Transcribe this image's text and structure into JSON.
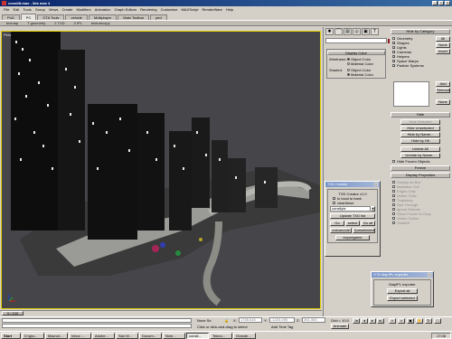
{
  "window": {
    "title": "constlit.max - 3ds max 4"
  },
  "menu": [
    "File",
    "Edit",
    "Tools",
    "Group",
    "Views",
    "Create",
    "Modifiers",
    "Animation",
    "Graph Editors",
    "Rendering",
    "Customize",
    "MAXScript",
    "RenderWare",
    "Help"
  ],
  "tabs": [
    {
      "label": "PoD"
    },
    {
      "label": "PC"
    },
    {
      "label": "GTA Tools"
    },
    {
      "label": "vehicle"
    },
    {
      "label": "Multiplayer"
    },
    {
      "label": "Main Toolbar"
    },
    {
      "label": "ped"
    }
  ],
  "toolrow": [
    "texmap",
    "T geometry",
    "2 TXD",
    "3 IPL",
    "texturecopy"
  ],
  "viewport": {
    "label": "Perspective"
  },
  "display_color": {
    "title": "Display Color",
    "wireframe_label": "Wireframe:",
    "shaded_label": "Shaded:",
    "object_color": "Object Color",
    "material_color": "Material Color"
  },
  "hide_by_category": {
    "title": "Hide by Category",
    "items": [
      {
        "label": "Geometry",
        "checked": false
      },
      {
        "label": "Shapes",
        "checked": true
      },
      {
        "label": "Lights",
        "checked": true
      },
      {
        "label": "Cameras",
        "checked": true
      },
      {
        "label": "Helpers",
        "checked": true
      },
      {
        "label": "Space Warps",
        "checked": true
      },
      {
        "label": "Particle Systems",
        "checked": true
      }
    ],
    "all": "All",
    "none": "None",
    "invert": "Invert",
    "add": "Add",
    "remove": "Remove",
    "none2": "None"
  },
  "hide": {
    "title": "Hide",
    "buttons": [
      "Hide Selected",
      "Hide Unselected",
      "Hide by Name...",
      "Hide by Hit",
      "Unhide All",
      "Unhide by Name...",
      "Hide Frozen Objects"
    ],
    "disabled": [
      true,
      false,
      false,
      false,
      false,
      false,
      false
    ]
  },
  "freeze": {
    "title": "Freeze"
  },
  "display_properties": {
    "title": "Display Properties",
    "items": [
      "Display as Box",
      "Backface Cull",
      "Edges Only",
      "Vertex Ticks",
      "Trajectory",
      "See-Through",
      "Ignore Extents",
      "Show Frozen in Gray",
      "Vertex Colors",
      "Shaded"
    ]
  },
  "txd_creator": {
    "window_title": "TXD Creator",
    "title": "TXD Creator v1.0",
    "inlocal_label": "to local to bank",
    "clearthese_label": "clearthese",
    "name_value": "constlytz",
    "update_btn": "Update TXD list",
    "go_btn": "Go",
    "select_btn": "select",
    "goall_btn": "Go all",
    "colorcode_btn": "colourcode",
    "pretty_btn": "7pmselected",
    "export_btn": "exportgame"
  },
  "map_exporter": {
    "window_title": "GTA MapIPL exporter",
    "title": "MapIPL exporter",
    "export_all": "Export all",
    "export_selected": "Export selected"
  },
  "timeline": {
    "slider": "0 / 100"
  },
  "status": {
    "none_selected": "None Se",
    "prompt": "Click or click-and-drag to select",
    "add_time_tag": "Add Time Tag",
    "x_label": "X:",
    "x_value": "1735.516",
    "y_label": "Y:",
    "y_value": "-1224.095",
    "z_label": "Z:",
    "z_value": "261.353",
    "grid": "Grid = 10.0",
    "animate": "Animate"
  },
  "taskbar": {
    "start": "Start",
    "items": [
      "D:\\gta...",
      "Macro4...",
      "Inbox -...",
      "Adobe...",
      "San M...",
      "Docum...",
      "Nvm...",
      "constl...",
      "Tekno...",
      "Grande..."
    ],
    "clock": "17:08"
  }
}
